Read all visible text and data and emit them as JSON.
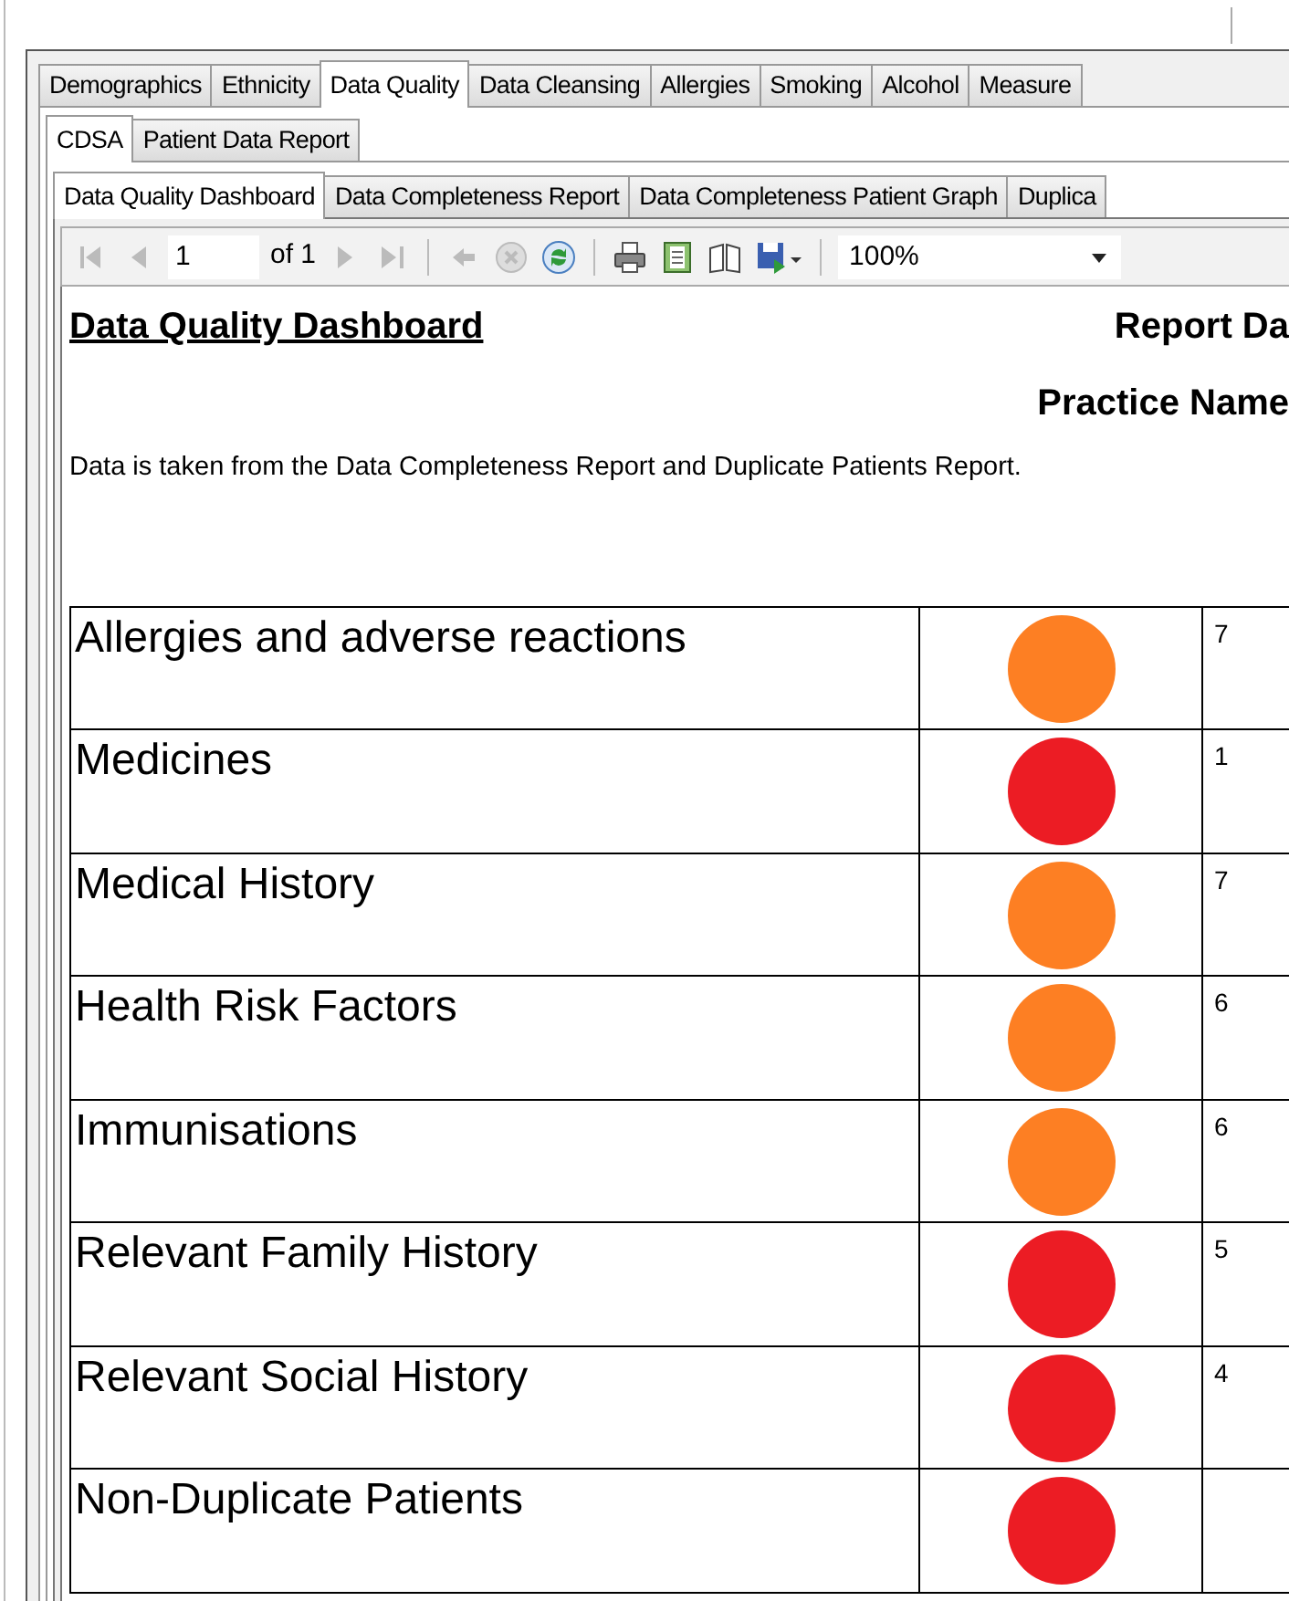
{
  "main_tabs": [
    {
      "label": "Demographics",
      "selected": false
    },
    {
      "label": "Ethnicity",
      "selected": false
    },
    {
      "label": "Data Quality",
      "selected": true
    },
    {
      "label": "Data Cleansing",
      "selected": false
    },
    {
      "label": "Allergies",
      "selected": false
    },
    {
      "label": "Smoking",
      "selected": false
    },
    {
      "label": "Alcohol",
      "selected": false
    },
    {
      "label": "Measure",
      "selected": false
    }
  ],
  "sub_tabs": [
    {
      "label": "CDSA",
      "selected": true
    },
    {
      "label": "Patient Data Report",
      "selected": false
    }
  ],
  "report_tabs": [
    {
      "label": "Data Quality Dashboard",
      "selected": true
    },
    {
      "label": "Data Completeness Report",
      "selected": false
    },
    {
      "label": "Data Completeness Patient Graph",
      "selected": false
    },
    {
      "label": "Duplica",
      "selected": false
    }
  ],
  "toolbar": {
    "page": "1",
    "of_pages": "of 1",
    "zoom": "100%"
  },
  "report": {
    "title": "Data Quality Dashboard",
    "report_date_label": "Report Da",
    "practice_name_label": "Practice Name",
    "description": "Data is taken from the Data Completeness Report and Duplicate Patients Report.",
    "rows": [
      {
        "label": "Allergies and adverse reactions",
        "color": "#fd7f23",
        "value": "7"
      },
      {
        "label": "Medicines",
        "color": "#ec1c24",
        "value": "1"
      },
      {
        "label": "Medical History",
        "color": "#fd7f23",
        "value": "7"
      },
      {
        "label": "Health Risk Factors",
        "color": "#fd7f23",
        "value": "6"
      },
      {
        "label": "Immunisations",
        "color": "#fd7f23",
        "value": "6"
      },
      {
        "label": "Relevant Family History",
        "color": "#ec1c24",
        "value": "5"
      },
      {
        "label": "Relevant Social History",
        "color": "#ec1c24",
        "value": "4"
      },
      {
        "label": "Non-Duplicate Patients",
        "color": "#ec1c24"
      }
    ]
  }
}
